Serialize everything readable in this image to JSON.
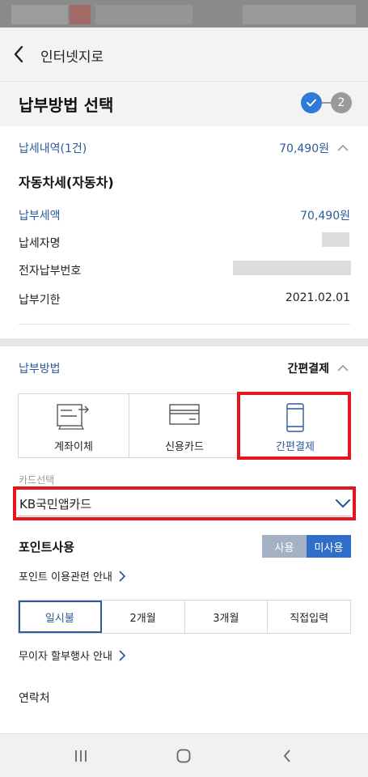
{
  "appbar": {
    "title": "인터넷지로"
  },
  "header": {
    "title": "납부방법 선택",
    "step_current": "2"
  },
  "summary": {
    "label": "납세내역(1건)",
    "amount": "70,490원"
  },
  "tax": {
    "name": "자동차세(자동차)",
    "rows": [
      {
        "label": "납부세액",
        "value": "70,490원"
      },
      {
        "label": "납세자명",
        "value": ""
      },
      {
        "label": "전자납부번호",
        "value": ""
      },
      {
        "label": "납부기한",
        "value": "2021.02.01"
      }
    ]
  },
  "payment": {
    "section_label": "납부방법",
    "selected_method": "간편결제",
    "methods": [
      {
        "label": "계좌이체",
        "icon": "account-transfer-icon"
      },
      {
        "label": "신용카드",
        "icon": "credit-card-icon"
      },
      {
        "label": "간편결제",
        "icon": "smartphone-icon"
      }
    ]
  },
  "card": {
    "caption": "카드선택",
    "selected": "KB국민앱카드"
  },
  "points": {
    "label": "포인트사용",
    "option_use": "사용",
    "option_nouse": "미사용",
    "selected": "미사용"
  },
  "points_info": {
    "label": "포인트 이용관련 안내"
  },
  "installments": {
    "options": [
      "일시불",
      "2개월",
      "3개월",
      "직접입력"
    ],
    "selected": "일시불"
  },
  "interest_free": {
    "label": "무이자 할부행사 안내"
  },
  "contact": {
    "label": "연락처"
  },
  "colors": {
    "accent": "#2d5a9a",
    "button_blue": "#2f6fc9",
    "highlight_red": "#e5141f"
  }
}
